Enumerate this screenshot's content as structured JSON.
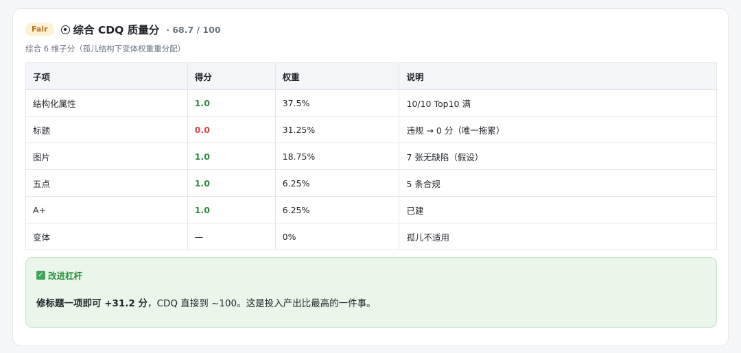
{
  "header": {
    "badge": "Fair",
    "title": "综合 CDQ 质量分",
    "score": "· 68.7 / 100",
    "icon": "target-icon"
  },
  "subtitle": "综合 6 维子分（孤儿结构下变体权重重分配）",
  "table": {
    "columns": [
      "子项",
      "得分",
      "权重",
      "说明"
    ],
    "rows": [
      {
        "item": "结构化属性",
        "score": "1.0",
        "status": "good",
        "weight": "37.5%",
        "note": "10/10 Top10 满"
      },
      {
        "item": "标题",
        "score": "0.0",
        "status": "bad",
        "weight": "31.25%",
        "note": "违规 → 0 分（唯一拖累）"
      },
      {
        "item": "图片",
        "score": "1.0",
        "status": "good",
        "weight": "18.75%",
        "note": "7 张无缺陷（假设）"
      },
      {
        "item": "五点",
        "score": "1.0",
        "status": "good",
        "weight": "6.25%",
        "note": "5 条合规"
      },
      {
        "item": "A+",
        "score": "1.0",
        "status": "good",
        "weight": "6.25%",
        "note": "已建"
      },
      {
        "item": "变体",
        "score": "—",
        "status": "neutral",
        "weight": "0%",
        "note": "孤儿不适用"
      }
    ]
  },
  "callout": {
    "heading": "改进杠杆",
    "icon": "check-icon",
    "strong": "修标题一项即可 +31.2 分",
    "text": "，CDQ 直接到 ~100。这是投入产出比最高的一件事。"
  },
  "colors": {
    "good": "#2b8a3e",
    "bad": "#d64545",
    "badge_bg": "#fff1d6",
    "badge_fg": "#b8741a",
    "callout_bg": "#eaf6ea"
  }
}
